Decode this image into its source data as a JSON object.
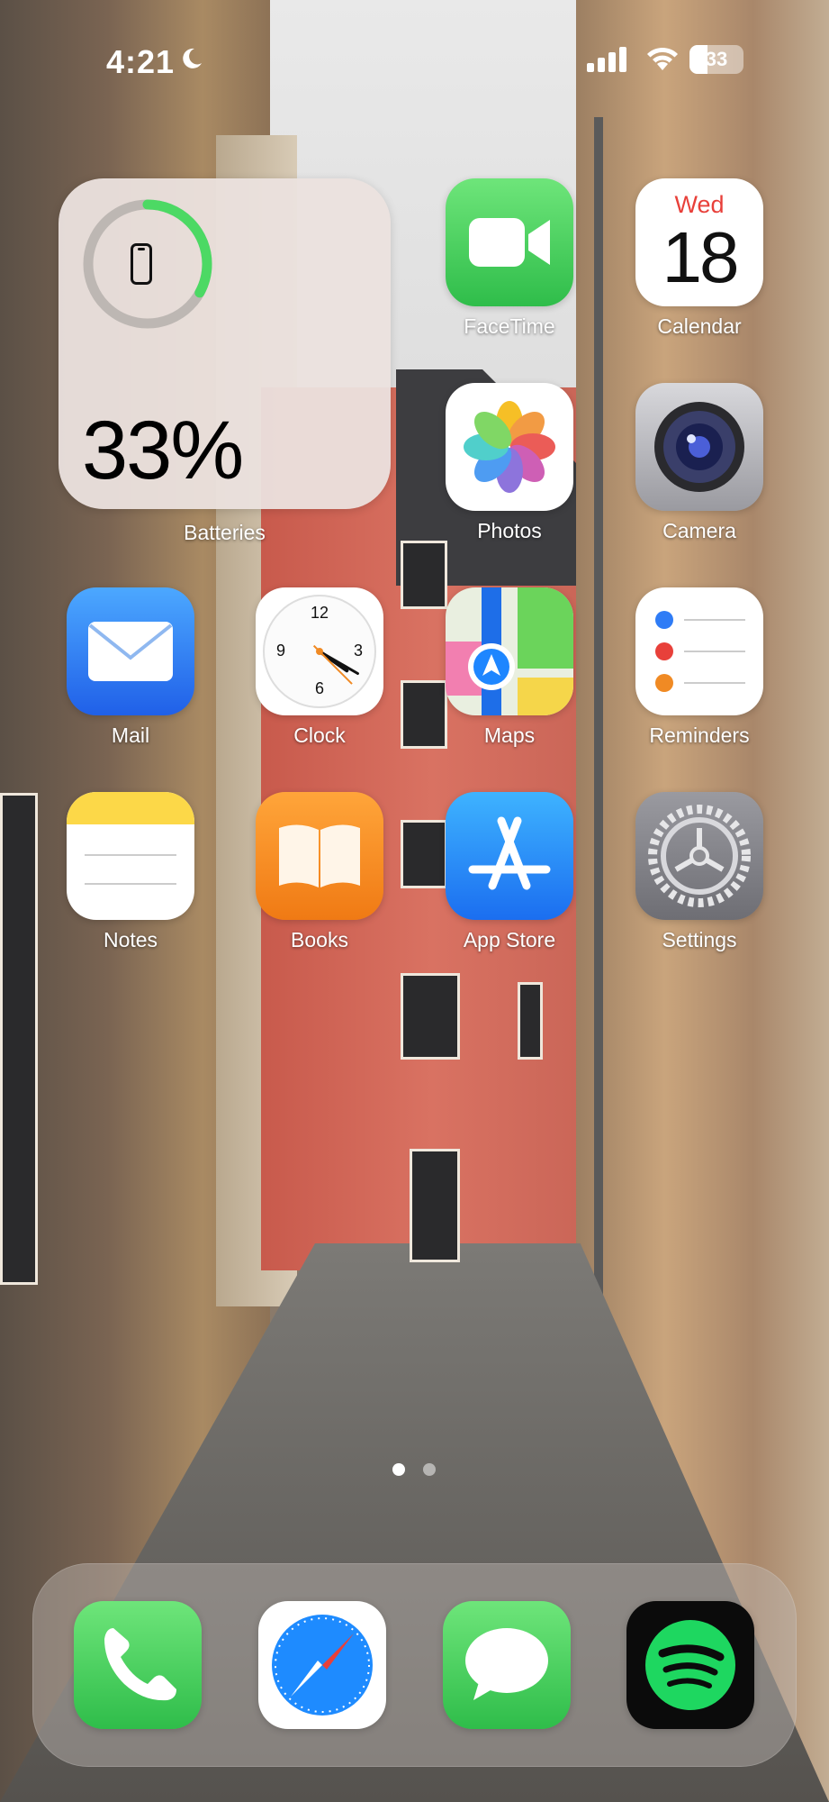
{
  "status_bar": {
    "time": "4:21",
    "battery_level": "33",
    "icons": [
      "moon-icon",
      "cellular-signal-icon",
      "wifi-icon",
      "battery-icon"
    ]
  },
  "widget": {
    "label": "Batteries",
    "percent_text": "33%",
    "level_fraction": 0.33,
    "ring_color": "#4cd964",
    "icon": "iphone-icon"
  },
  "apps": [
    {
      "label": "FaceTime",
      "icon": "facetime-icon"
    },
    {
      "label": "Calendar",
      "icon": "calendar-icon",
      "day_name": "Wed",
      "day_number": "18"
    },
    {
      "label": "Photos",
      "icon": "photos-icon"
    },
    {
      "label": "Camera",
      "icon": "camera-icon"
    },
    {
      "label": "Mail",
      "icon": "mail-icon"
    },
    {
      "label": "Clock",
      "icon": "clock-icon",
      "numerals": [
        "12",
        "3",
        "6",
        "9"
      ]
    },
    {
      "label": "Maps",
      "icon": "maps-icon"
    },
    {
      "label": "Reminders",
      "icon": "reminders-icon"
    },
    {
      "label": "Notes",
      "icon": "notes-icon"
    },
    {
      "label": "Books",
      "icon": "books-icon"
    },
    {
      "label": "App Store",
      "icon": "app-store-icon"
    },
    {
      "label": "Settings",
      "icon": "settings-icon"
    }
  ],
  "page_indicator": {
    "pages": 2,
    "current": 1
  },
  "dock": [
    {
      "app": "Phone",
      "icon": "phone-icon"
    },
    {
      "app": "Safari",
      "icon": "safari-icon"
    },
    {
      "app": "Messages",
      "icon": "messages-icon"
    },
    {
      "app": "Spotify",
      "icon": "spotify-icon"
    }
  ],
  "colors": {
    "facetime": "#4cd964",
    "mail": "#2f7cf6",
    "books": "#f08a24",
    "app_store": "#1f8bff",
    "settings": "#8e8e93",
    "spotify": "#1ed760",
    "calendar_day": "#e8403a"
  }
}
